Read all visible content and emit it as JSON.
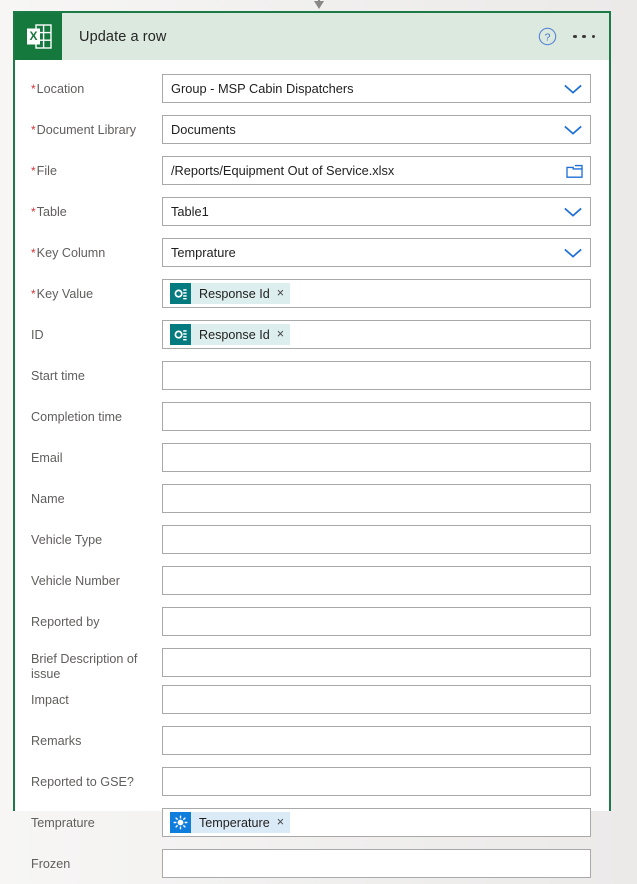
{
  "connector": {
    "icon": "arrow-down-icon"
  },
  "card": {
    "header": {
      "app_icon": "excel-icon",
      "title": "Update a row",
      "help_icon": "help-circle-icon",
      "more_label": "more-options-icon"
    },
    "accent_color": "#1b7a46",
    "header_bg": "#dce9df"
  },
  "fields": [
    {
      "label": "Location",
      "required": true,
      "type": "dropdown",
      "value": "Group - MSP Cabin Dispatchers",
      "icon": "chevron-down-icon"
    },
    {
      "label": "Document Library",
      "required": true,
      "type": "dropdown",
      "value": "Documents",
      "icon": "chevron-down-icon"
    },
    {
      "label": "File",
      "required": true,
      "type": "filepicker",
      "value": "/Reports/Equipment Out of Service.xlsx",
      "icon": "folder-icon"
    },
    {
      "label": "Table",
      "required": true,
      "type": "dropdown",
      "value": "Table1",
      "icon": "chevron-down-icon"
    },
    {
      "label": "Key Column",
      "required": true,
      "type": "dropdown",
      "value": "Temprature",
      "icon": "chevron-down-icon"
    },
    {
      "label": "Key Value",
      "required": true,
      "type": "token",
      "value": "",
      "token": {
        "text": "Response Id",
        "icon": "microsoft-forms-icon",
        "style": "forms",
        "remove": "×"
      }
    },
    {
      "label": "ID",
      "required": false,
      "type": "token",
      "value": "",
      "token": {
        "text": "Response Id",
        "icon": "microsoft-forms-icon",
        "style": "forms",
        "remove": "×"
      }
    },
    {
      "label": "Start time",
      "required": false,
      "type": "text",
      "value": ""
    },
    {
      "label": "Completion time",
      "required": false,
      "type": "text",
      "value": ""
    },
    {
      "label": "Email",
      "required": false,
      "type": "text",
      "value": ""
    },
    {
      "label": "Name",
      "required": false,
      "type": "text",
      "value": ""
    },
    {
      "label": "Vehicle Type",
      "required": false,
      "type": "text",
      "value": ""
    },
    {
      "label": "Vehicle Number",
      "required": false,
      "type": "text",
      "value": ""
    },
    {
      "label": "Reported by",
      "required": false,
      "type": "text",
      "value": ""
    },
    {
      "label": "Brief Description of issue",
      "required": false,
      "type": "text",
      "value": "",
      "two_line": true
    },
    {
      "label": "Impact",
      "required": false,
      "type": "text",
      "value": ""
    },
    {
      "label": "Remarks",
      "required": false,
      "type": "text",
      "value": ""
    },
    {
      "label": "Reported to GSE?",
      "required": false,
      "type": "text",
      "value": ""
    },
    {
      "label": "Temprature",
      "required": false,
      "type": "token",
      "value": "",
      "token": {
        "text": "Temperature",
        "icon": "variable-burst-icon",
        "style": "variable",
        "remove": "×"
      }
    },
    {
      "label": "Frozen",
      "required": false,
      "type": "text",
      "value": ""
    }
  ]
}
